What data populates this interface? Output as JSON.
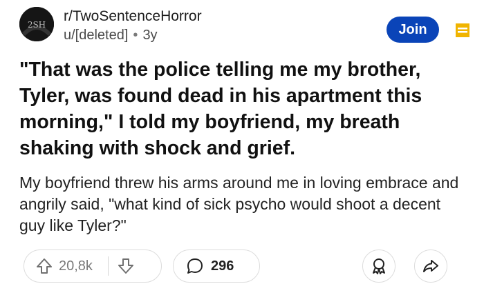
{
  "post": {
    "subreddit": "r/TwoSentenceHorror",
    "author": "u/[deleted]",
    "separator": "•",
    "age": "3y",
    "avatar_text": "2SH",
    "join_label": "Join",
    "title": "\"That was the police telling me my brother, Tyler, was found dead in his apartment this morning,\" I told my boyfriend, my breath shaking with shock and grief.",
    "body": "My boyfriend threw his arms around me in loving embrace and angrily said, \"what kind of sick psycho would shoot a decent guy like Tyler?\""
  },
  "actions": {
    "upvotes": "20,8k",
    "comments": "296",
    "icons": [
      "upvote-icon",
      "downvote-icon",
      "comment-icon",
      "award-icon",
      "share-icon",
      "archive-icon"
    ]
  },
  "colors": {
    "join_bg": "#0a44b8",
    "archive_icon": "#f0b400",
    "text": "#111111",
    "muted": "#7a7a7a"
  }
}
